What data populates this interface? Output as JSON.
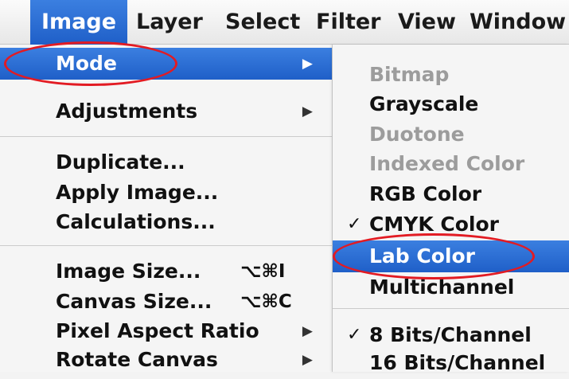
{
  "menubar": {
    "items": [
      {
        "label": "Image"
      },
      {
        "label": "Layer"
      },
      {
        "label": "Select"
      },
      {
        "label": "Filter"
      },
      {
        "label": "View"
      },
      {
        "label": "Window"
      }
    ]
  },
  "image_menu": {
    "mode": "Mode",
    "adjustments": "Adjustments",
    "duplicate": "Duplicate...",
    "apply_image": "Apply Image...",
    "calculations": "Calculations...",
    "image_size": "Image Size...",
    "image_size_shortcut": "⌥⌘I",
    "canvas_size": "Canvas Size...",
    "canvas_size_shortcut": "⌥⌘C",
    "pixel_aspect_ratio": "Pixel Aspect Ratio",
    "rotate_canvas": "Rotate Canvas"
  },
  "mode_submenu": {
    "bitmap": "Bitmap",
    "grayscale": "Grayscale",
    "duotone": "Duotone",
    "indexed_color": "Indexed Color",
    "rgb_color": "RGB Color",
    "cmyk_color": "CMYK Color",
    "lab_color": "Lab Color",
    "multichannel": "Multichannel",
    "bits8": "8 Bits/Channel",
    "bits16": "16 Bits/Channel",
    "checkmark": "✓"
  },
  "annotation_color": "#e21b23",
  "highlight_color": "#2a6fd6"
}
